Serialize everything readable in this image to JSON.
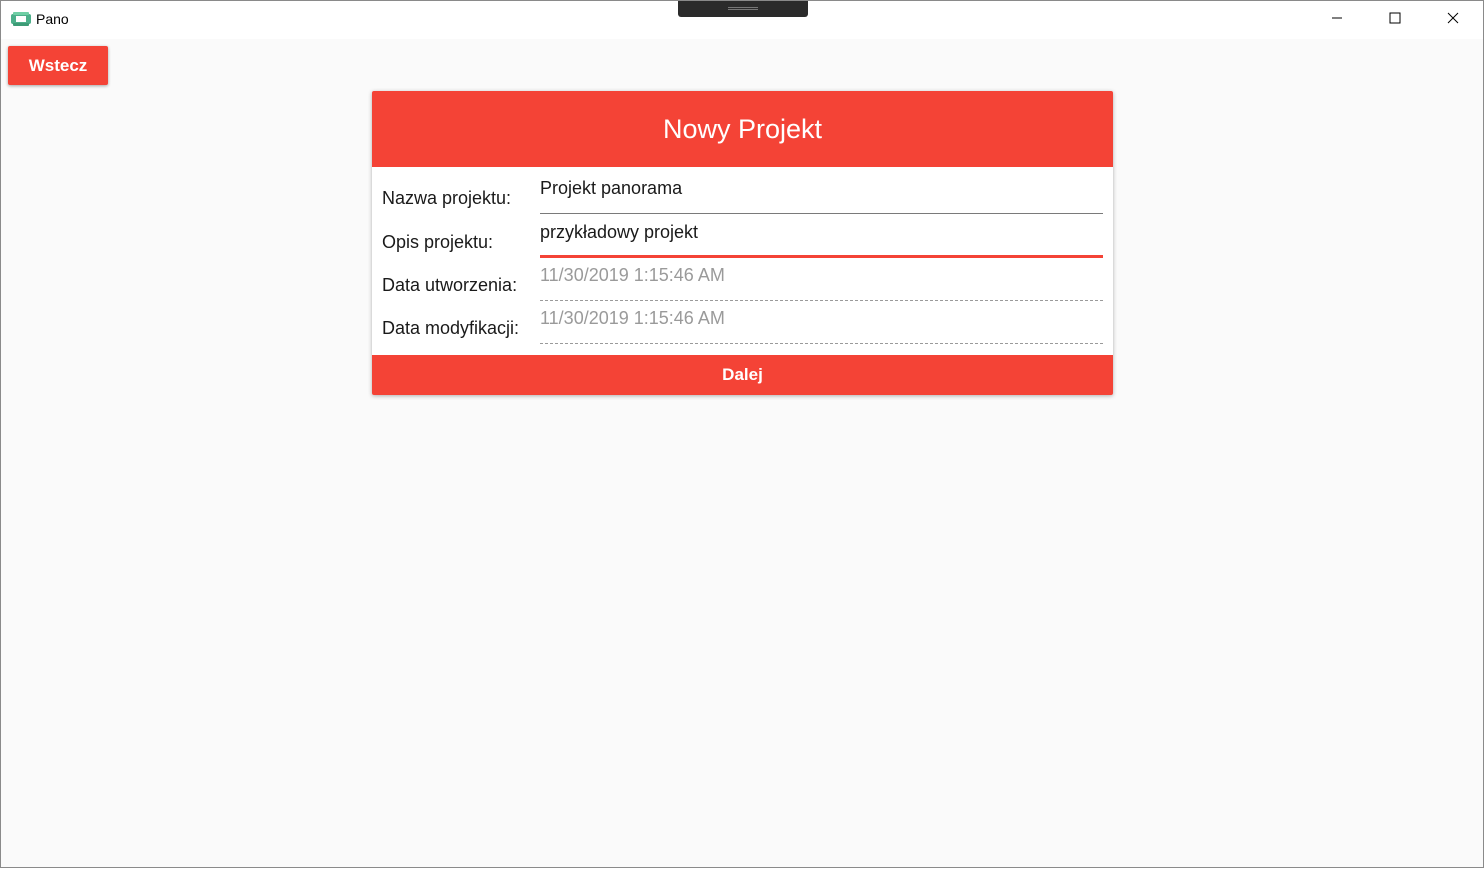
{
  "window": {
    "title": "Pano"
  },
  "toolbar": {
    "back_label": "Wstecz"
  },
  "form": {
    "header": "Nowy Projekt",
    "fields": [
      {
        "label": "Nazwa projektu:",
        "value": "Projekt panorama",
        "state": "normal"
      },
      {
        "label": "Opis projektu:",
        "value": "przykładowy projekt",
        "state": "focused"
      },
      {
        "label": "Data utworzenia:",
        "value": "11/30/2019 1:15:46 AM",
        "state": "readonly"
      },
      {
        "label": "Data modyfikacji:",
        "value": "11/30/2019 1:15:46 AM",
        "state": "readonly"
      }
    ],
    "next_label": "Dalej"
  },
  "colors": {
    "accent": "#f44336",
    "background": "#fafafa",
    "card": "#ffffff",
    "readonly_text": "#9a9a9a"
  },
  "icons": {
    "app": "pano-360-icon",
    "minimize": "minimize-icon",
    "maximize": "maximize-icon",
    "close": "close-icon"
  }
}
